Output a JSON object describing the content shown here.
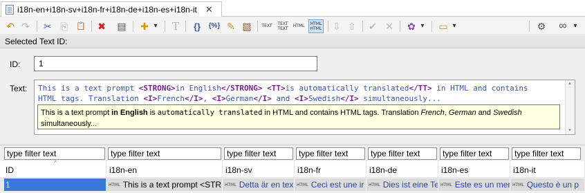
{
  "editor_tab": {
    "title": "i18n-en+i18n-sv+i18n-fr+i18n-de+i18n-es+i18n-it",
    "close_glyph": "✕"
  },
  "toolbar": {
    "icons": [
      {
        "name": "undo-icon",
        "glyph": "↶"
      },
      {
        "name": "redo-icon",
        "glyph": "↷"
      },
      {
        "name": "cut-icon",
        "glyph": "✂"
      },
      {
        "name": "copy-icon",
        "glyph": "⎘"
      },
      {
        "name": "paste-icon",
        "glyph": "📋"
      },
      {
        "name": "delete-icon",
        "glyph": "✖"
      },
      {
        "name": "table-view-icon",
        "glyph": "▤"
      },
      {
        "name": "add-icon",
        "glyph": "✚"
      },
      {
        "name": "dropdown-icon",
        "glyph": "▾"
      },
      {
        "name": "translate-icon",
        "glyph": "T"
      },
      {
        "name": "braces-icon",
        "glyph": "{}"
      },
      {
        "name": "parameters-icon",
        "glyph": "{%}"
      },
      {
        "name": "edit-icon",
        "glyph": "✎"
      },
      {
        "name": "picture-icon",
        "glyph": "▧"
      },
      {
        "name": "arrow-down-icon",
        "glyph": "⇩"
      },
      {
        "name": "arrow-up-icon",
        "glyph": "⇧"
      },
      {
        "name": "check-icon",
        "glyph": "✔"
      },
      {
        "name": "cross-icon",
        "glyph": "✕"
      },
      {
        "name": "language-icon",
        "glyph": "✿"
      },
      {
        "name": "notes-icon",
        "glyph": "▭"
      },
      {
        "name": "settings-icon",
        "glyph": "⚙"
      },
      {
        "name": "glasses-icon",
        "glyph": "∞"
      }
    ],
    "text_buttons": [
      "TEXT",
      "TEXT\nTEXT",
      "HTML",
      "HTML\nHTML"
    ]
  },
  "section_title": "Selected Text ID:",
  "details": {
    "id_label": "ID:",
    "id_value": "1",
    "text_label": "Text:",
    "source_line1_parts": [
      {
        "t": "This is a text prompt ",
        "tag": false
      },
      {
        "t": "<STRONG>",
        "tag": true
      },
      {
        "t": "in English",
        "tag": false
      },
      {
        "t": "</STRONG>",
        "tag": true
      },
      {
        "t": " ",
        "tag": false
      },
      {
        "t": "<TT>",
        "tag": true
      },
      {
        "t": "is automatically translated",
        "tag": false
      },
      {
        "t": "</TT>",
        "tag": true
      },
      {
        "t": " in HTML and contains",
        "tag": false
      }
    ],
    "source_line2_parts": [
      {
        "t": "HTML tags. Translation ",
        "tag": false
      },
      {
        "t": "<I>",
        "tag": true
      },
      {
        "t": "French",
        "tag": false
      },
      {
        "t": "</I>",
        "tag": true
      },
      {
        "t": ", ",
        "tag": false
      },
      {
        "t": "<I>",
        "tag": true
      },
      {
        "t": "German",
        "tag": false
      },
      {
        "t": "</I>",
        "tag": true
      },
      {
        "t": " and ",
        "tag": false
      },
      {
        "t": "<I>",
        "tag": true
      },
      {
        "t": "Swedish",
        "tag": false
      },
      {
        "t": "</I>",
        "tag": true
      },
      {
        "t": " simultaneously...",
        "tag": false
      }
    ],
    "tooltip": {
      "p1": "This is a text prompt ",
      "strong": "in English",
      "p2": " is ",
      "mono": "automatically translated",
      "p3": " in HTML and contains HTML tags. Translation ",
      "i1": "French",
      "c1": ", ",
      "i2": "German",
      "c2": " and ",
      "i3": "Swedish",
      "p4": "simultaneously..."
    }
  },
  "table": {
    "filter_placeholder": "type filter text",
    "columns": [
      "ID",
      "i18n-en",
      "i18n-sv",
      "i18n-fr",
      "i18n-de",
      "i18n-es",
      "i18n-it"
    ],
    "html_badge": "HTML",
    "row": {
      "id": "1",
      "en": "This is a text prompt <STR",
      "sv": "Detta är en tex",
      "fr": "Ceci est une ir",
      "de": "Dies ist eine Te",
      "es": "Este es un mer",
      "it": "Questo è un p"
    }
  },
  "colors": {
    "selection": "#3a78d6",
    "tag": "#7a1f8f",
    "source_text": "#3a56b0",
    "tooltip_bg": "#ffffe1"
  }
}
